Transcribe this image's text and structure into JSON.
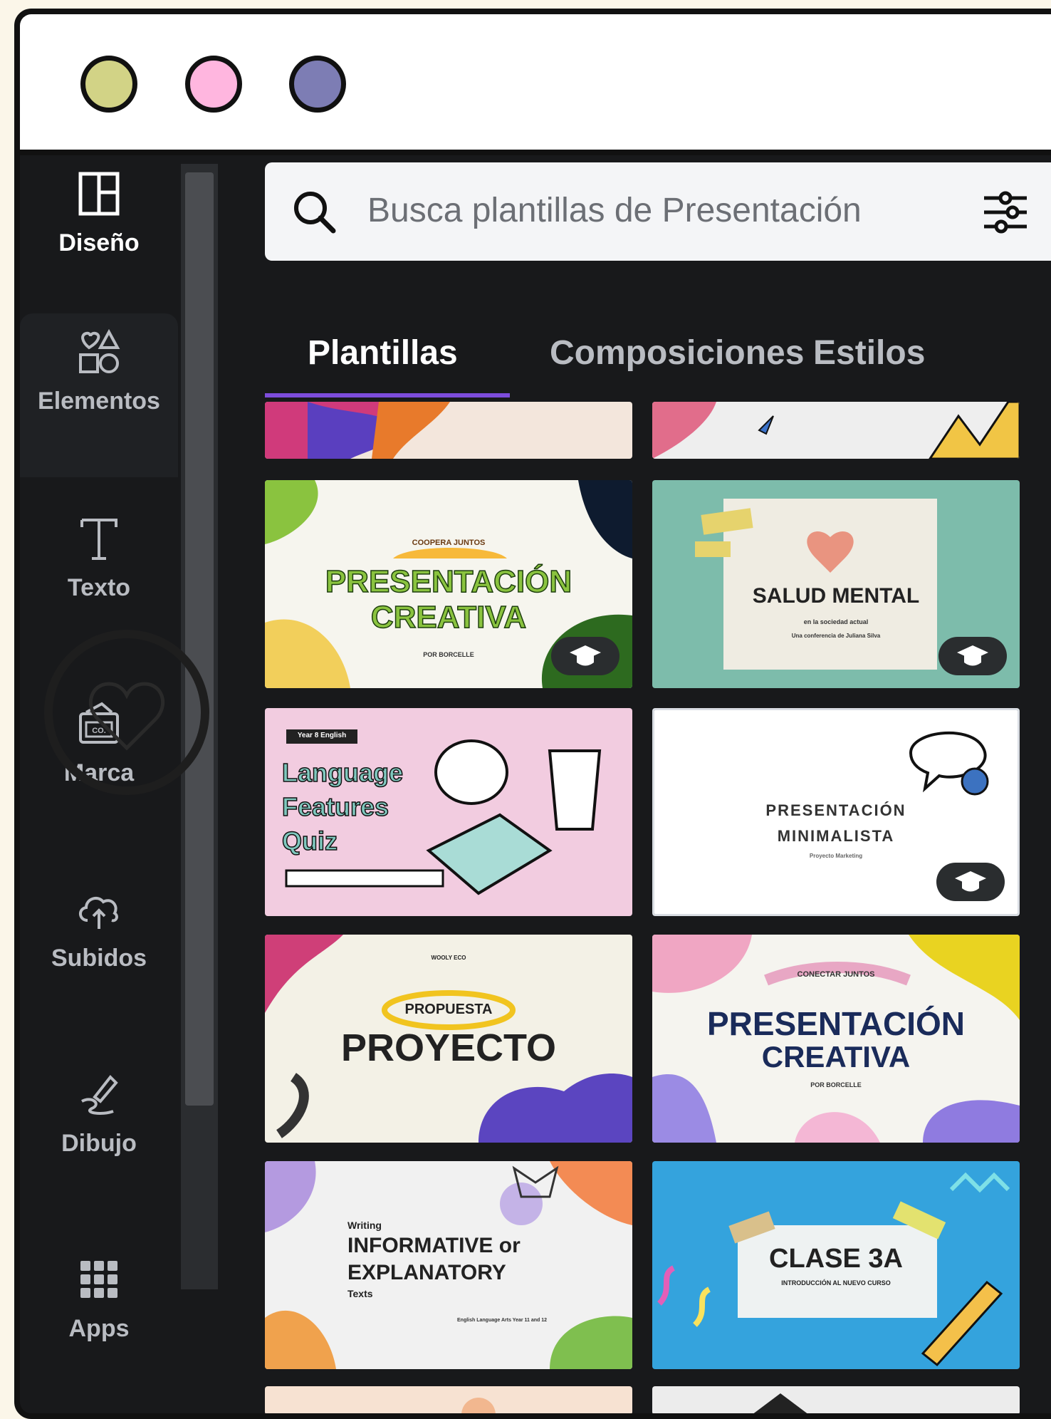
{
  "window": {
    "traffic_lights": [
      {
        "name": "dot-yellow",
        "color": "#d2d386"
      },
      {
        "name": "dot-pink",
        "color": "#ffb6df"
      },
      {
        "name": "dot-purple",
        "color": "#7d7db4"
      }
    ]
  },
  "sidebar": {
    "items": [
      {
        "label": "Diseño",
        "icon": "layout-icon"
      },
      {
        "label": "Elementos",
        "icon": "shapes-icon"
      },
      {
        "label": "Texto",
        "icon": "text-icon"
      },
      {
        "label": "Marca",
        "icon": "brand-icon"
      },
      {
        "label": "Subidos",
        "icon": "cloud-upload-icon"
      },
      {
        "label": "Dibujo",
        "icon": "draw-icon"
      },
      {
        "label": "Apps",
        "icon": "apps-grid-icon"
      }
    ]
  },
  "search": {
    "placeholder": "Busca plantillas de Presentación",
    "icon": "search-icon",
    "filter_icon": "filter-icon"
  },
  "tabs": [
    {
      "label": "Plantillas",
      "active": true
    },
    {
      "label": "Composiciones",
      "active": false
    },
    {
      "label": "Estilos",
      "active": false
    }
  ],
  "templates": [
    {
      "title_line1": "PRESENTACIÓN",
      "title_line2": "CREATIVA",
      "badge": "COOPERA JUNTOS",
      "sub": "POR BORCELLE"
    },
    {
      "title_line1": "SALUD MENTAL",
      "sub": "en la sociedad actual",
      "sub2": "Una conferencia de Juliana Silva"
    },
    {
      "title_line1": "Language",
      "title_line2": "Features",
      "title_line3": "Quiz",
      "tag": "Year 8 English"
    },
    {
      "title_line1": "PRESENTACIÓN",
      "title_line2": "MINIMALISTA",
      "sub": "Proyecto Marketing"
    },
    {
      "title_line1": "PROPUESTA",
      "title_line2": "PROYECTO",
      "tag": "WOOLY ECO"
    },
    {
      "title_line1": "PRESENTACIÓN",
      "title_line2": "CREATIVA",
      "badge": "CONECTAR JUNTOS",
      "sub": "POR BORCELLE"
    },
    {
      "title_line1": "Writing",
      "title_line2": "INFORMATIVE or",
      "title_line3": "EXPLANATORY",
      "title_line4": "Texts",
      "sub": "English Language Arts Year 11 and 12"
    },
    {
      "title_line1": "CLASE 3A",
      "sub": "INTRODUCCIÓN AL NUEVO CURSO"
    }
  ],
  "colors": {
    "accent": "#7d4cdb",
    "panel_bg": "#18191b",
    "page_bg": "#fbf6e9"
  }
}
